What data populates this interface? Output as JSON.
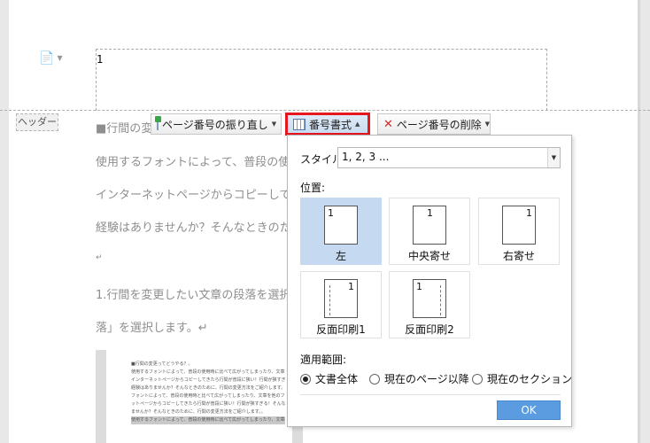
{
  "header": {
    "page_number": "1",
    "tag_label": "ヘッダー"
  },
  "toolbar": {
    "renumber_label": "ページ番号の振り直し",
    "format_label": "番号書式",
    "delete_label": "ページ番号の削除"
  },
  "document": {
    "lines": [
      "■行間の変",
      "使用するフォントによって、普段の使",
      "インターネットページからコピーして",
      "経験はありませんか？そんなときのた",
      "↵",
      "1.行間を変更したい文章の段落を選択",
      "落」を選択します。↵"
    ],
    "thumbnail_lines": [
      "■行間の変更ってどうやる？。",
      "使用するフォントによって、普段の使用時に比べて広がってしまったり、文章を他のファイルや",
      "インターネットページからコピーしてきたら行間が普段に狭い！行間が狭すぎる！そんな",
      "経験はありませんか？そんなときのために、行間の変更方法をご紹介します。使用する",
      "フォントによって、普段の使用時と比べて広がってしまったり、文章を他のファイルやインターネ",
      "ットページからコピーしてきたら行間が普段に狭い！行間が狭すぎる！そんな経験はあり",
      "ませんか？そんなときのために、行間の変更方法をご紹介します。。",
      "使用するフォントによって、普段の使用時に比べて広がってしまったり、文章を他のファイルや"
    ]
  },
  "panel": {
    "style_label": "スタイル:",
    "style_value": "1, 2, 3 ...",
    "position_label": "位置:",
    "positions": [
      {
        "label": "左",
        "number": "1"
      },
      {
        "label": "中央寄せ",
        "number": "1"
      },
      {
        "label": "右寄せ",
        "number": "1"
      },
      {
        "label": "反面印刷1",
        "number": "1"
      },
      {
        "label": "反面印刷2",
        "number": "1"
      }
    ],
    "selected_position": "左",
    "scope_label": "適用範囲:",
    "scopes": [
      "文書全体",
      "現在のページ以降",
      "現在のセクション"
    ],
    "selected_scope": "文書全体",
    "ok_label": "OK"
  },
  "colors": {
    "highlight_border": "#e8161e",
    "selected_option": "#c5d9f0",
    "ok_button": "#5b9be0"
  }
}
